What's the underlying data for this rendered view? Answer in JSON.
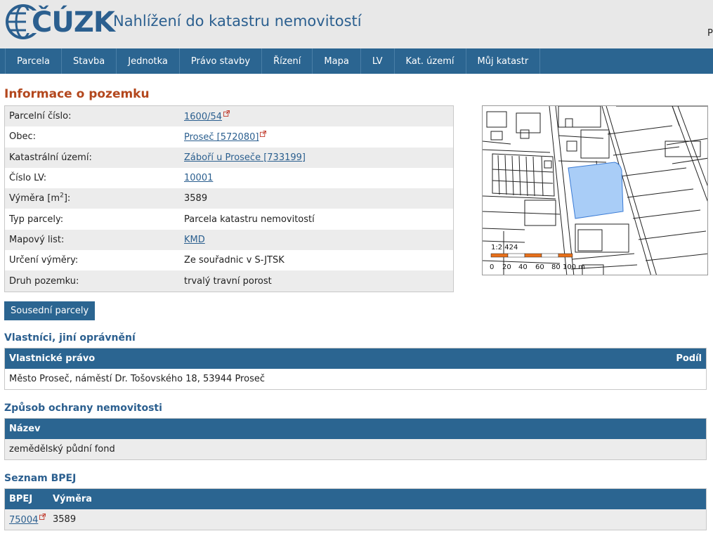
{
  "header": {
    "logo_text": "ČÚZK",
    "title": "Nahlížení do katastru nemovitostí",
    "corner_text": "P"
  },
  "nav": {
    "items": [
      {
        "label": "Parcela"
      },
      {
        "label": "Stavba"
      },
      {
        "label": "Jednotka"
      },
      {
        "label": "Právo stavby"
      },
      {
        "label": "Řízení"
      },
      {
        "label": "Mapa"
      },
      {
        "label": "LV"
      },
      {
        "label": "Kat. území"
      },
      {
        "label": "Můj katastr"
      }
    ]
  },
  "info": {
    "title": "Informace o pozemku",
    "rows": [
      {
        "label": "Parcelní číslo:",
        "value": "1600/54",
        "link": true,
        "external": true
      },
      {
        "label": "Obec:",
        "value": "Proseč [572080]",
        "link": true,
        "external": true
      },
      {
        "label": "Katastrální území:",
        "value": "Záboří u Proseče [733199]",
        "link": true,
        "external": false
      },
      {
        "label": "Číslo LV:",
        "value": "10001",
        "link": true,
        "external": false
      },
      {
        "label": "Výměra [m",
        "label_sup": "2",
        "label_after": "]:",
        "value": "3589",
        "link": false
      },
      {
        "label": "Typ parcely:",
        "value": "Parcela katastru nemovitostí",
        "link": false
      },
      {
        "label": "Mapový list:",
        "value": "KMD",
        "link": true,
        "external": false
      },
      {
        "label": "Určení výměry:",
        "value": "Ze souřadnic v S-JTSK",
        "link": false
      },
      {
        "label": "Druh pozemku:",
        "value": "trvalý travní porost",
        "link": false
      }
    ]
  },
  "map": {
    "scale_label": "1:2 424",
    "scale_ticks": [
      "0",
      "20",
      "40",
      "60",
      "80",
      "100 m"
    ],
    "parcel_color": "#a9cdf7",
    "scale_color": "#e8701a"
  },
  "neighbors_button": "Sousední parcely",
  "owners": {
    "title": "Vlastníci, jiní oprávnění",
    "col_left": "Vlastnické právo",
    "col_right": "Podíl",
    "rows": [
      "Město Proseč, náměstí Dr. Tošovského 18, 53944 Proseč"
    ]
  },
  "protection": {
    "title": "Způsob ochrany nemovitosti",
    "col": "Název",
    "rows": [
      "zemědělský půdní fond"
    ]
  },
  "bpej": {
    "title": "Seznam BPEJ",
    "col_bpej": "BPEJ",
    "col_area": "Výměra",
    "rows": [
      {
        "bpej": "75004",
        "area": "3589"
      }
    ]
  },
  "colors": {
    "brand_blue": "#2b6591",
    "title_orange": "#b3471d",
    "link_blue": "#2b5f8f",
    "external_icon": "#c0392b"
  }
}
